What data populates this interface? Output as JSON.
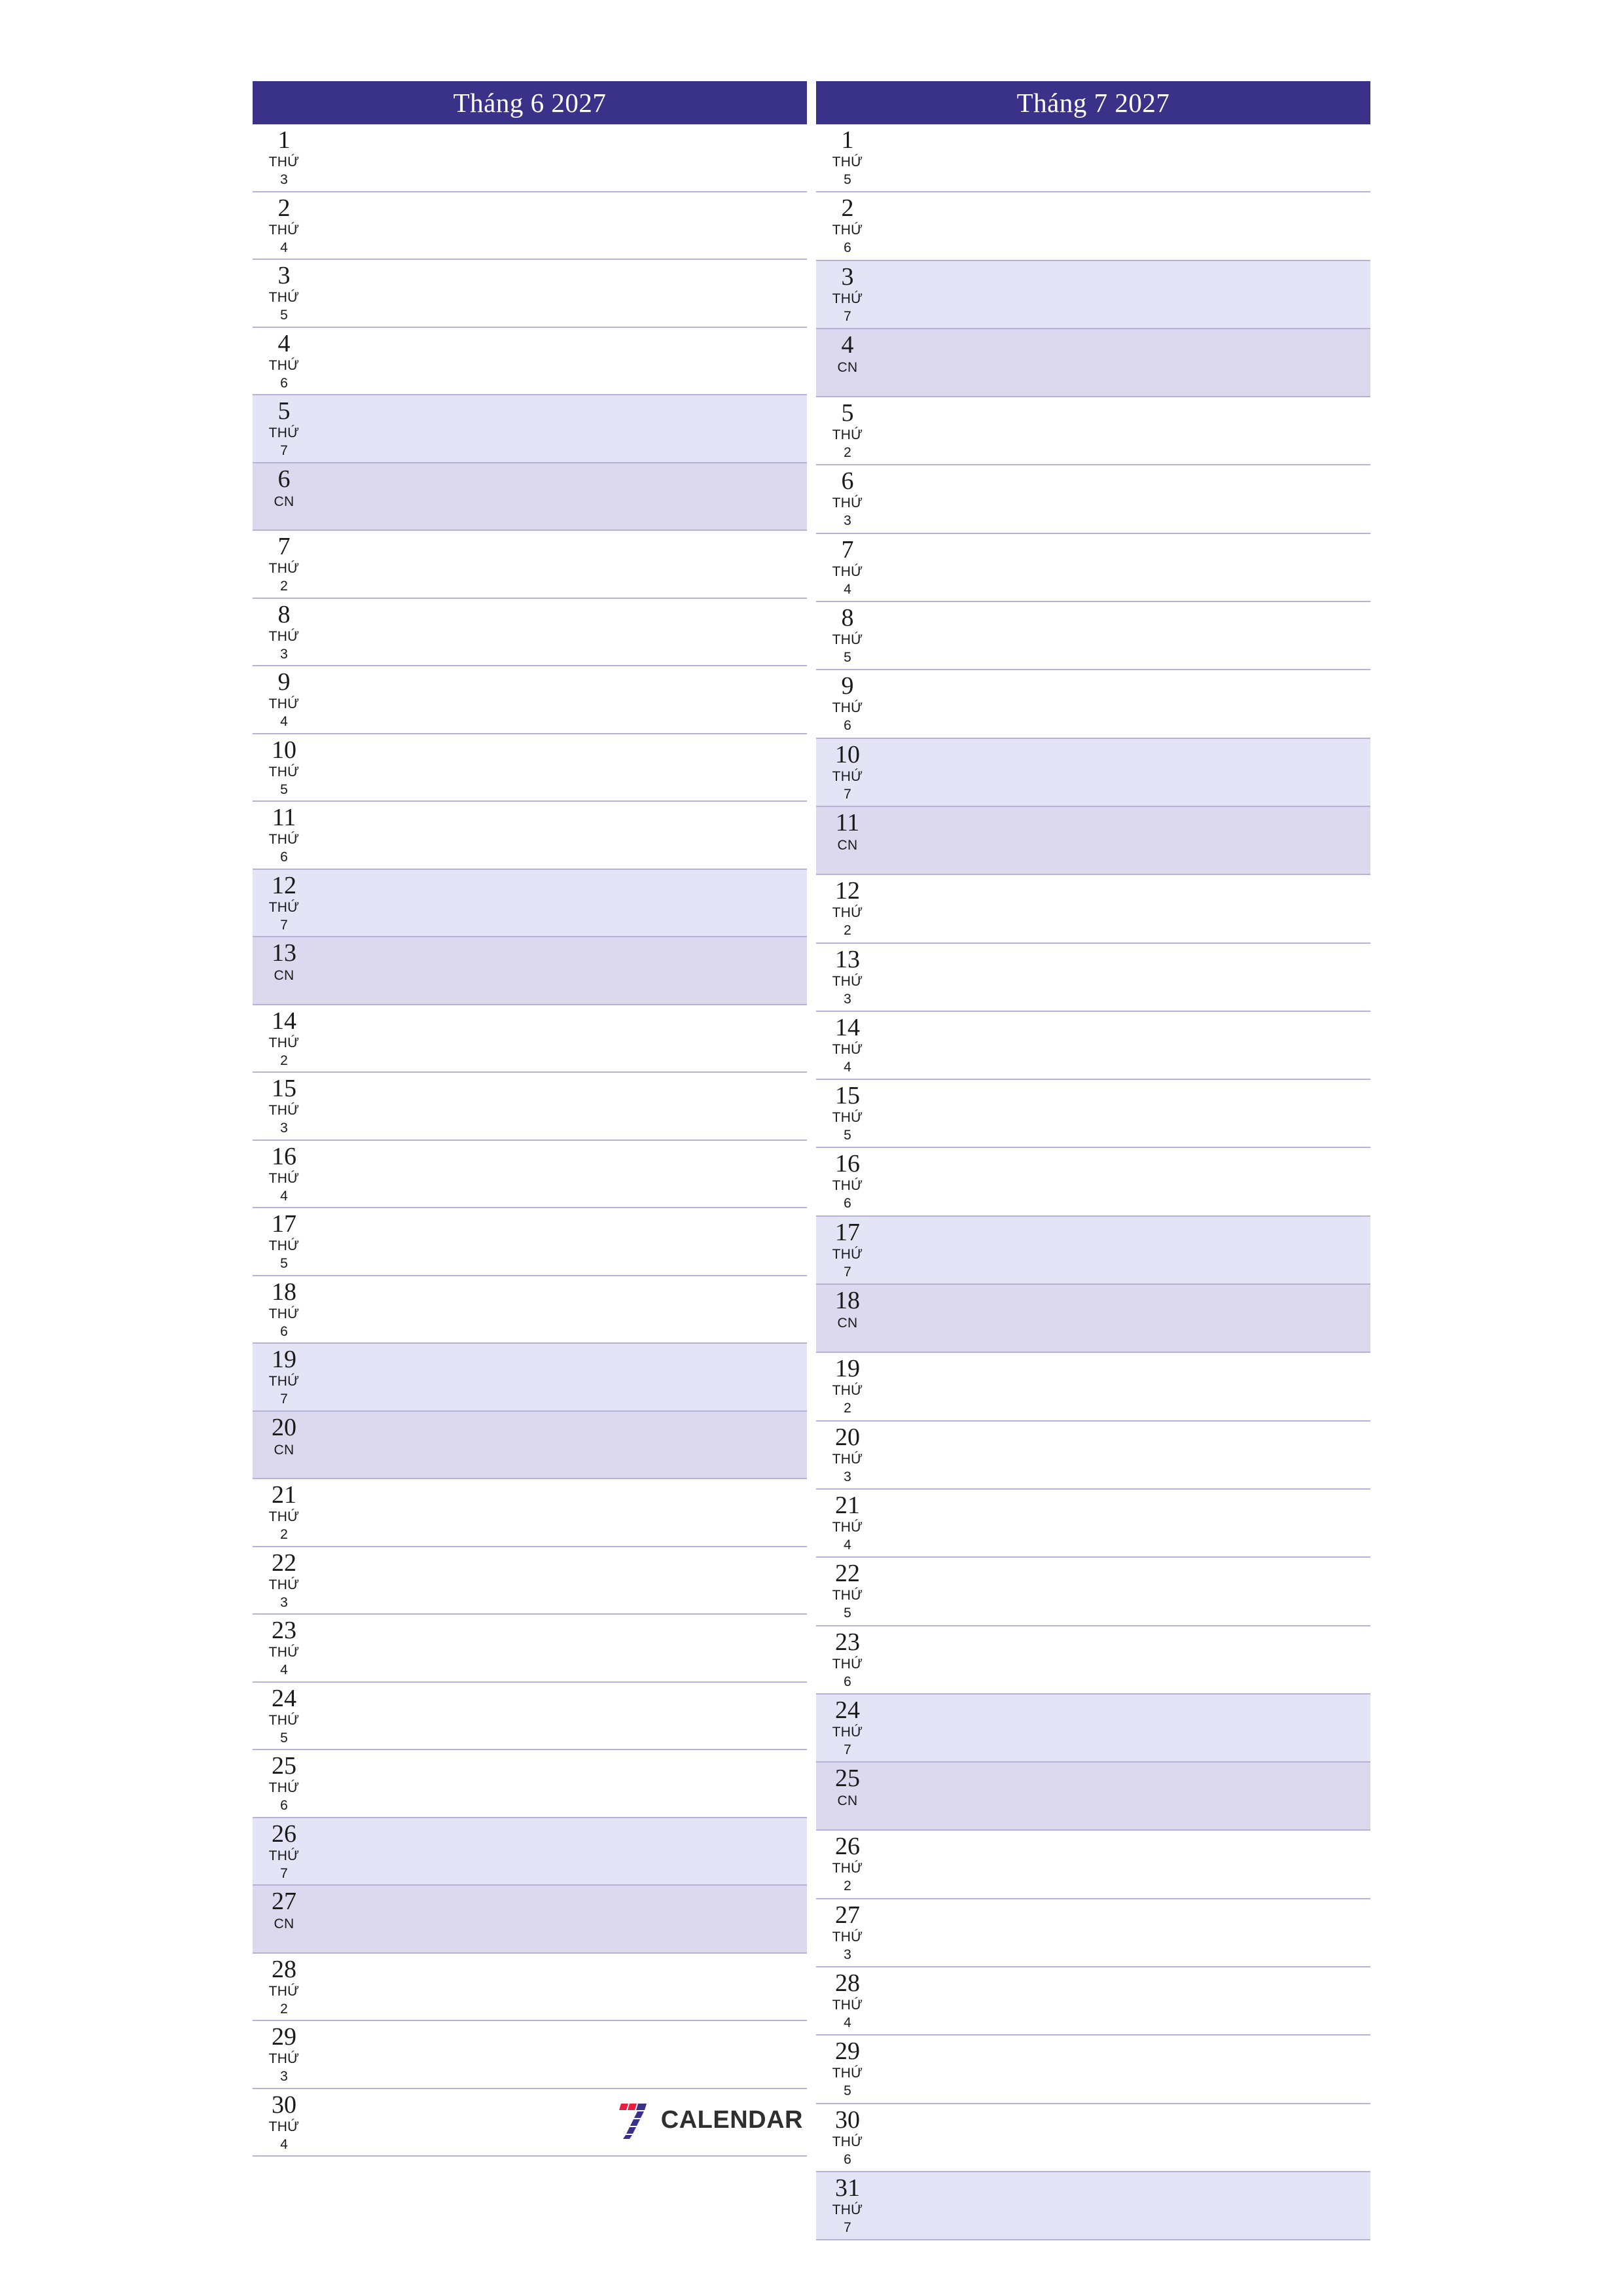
{
  "page": {
    "background_color": "#ffffff",
    "accent_color": "#3a3189",
    "saturday_color": "#e4e4f7",
    "sunday_color": "#dcd8ed",
    "rule_color": "#b5b2d6"
  },
  "logo": {
    "mark": "seven-stripes-icon",
    "text": "CALENDAR",
    "stripe_red": "#ec1c3d",
    "stripe_blue": "#3a3189"
  },
  "months": [
    {
      "title": "Tháng 6 2027",
      "name": "Tháng 6",
      "year": "2027",
      "days": [
        {
          "num": "1",
          "dow_word": "THỨ",
          "dow_num": "3",
          "type": "weekday"
        },
        {
          "num": "2",
          "dow_word": "THỨ",
          "dow_num": "4",
          "type": "weekday"
        },
        {
          "num": "3",
          "dow_word": "THỨ",
          "dow_num": "5",
          "type": "weekday"
        },
        {
          "num": "4",
          "dow_word": "THỨ",
          "dow_num": "6",
          "type": "weekday"
        },
        {
          "num": "5",
          "dow_word": "THỨ",
          "dow_num": "7",
          "type": "saturday"
        },
        {
          "num": "6",
          "dow_word": "CN",
          "dow_num": "",
          "type": "sunday"
        },
        {
          "num": "7",
          "dow_word": "THỨ",
          "dow_num": "2",
          "type": "weekday"
        },
        {
          "num": "8",
          "dow_word": "THỨ",
          "dow_num": "3",
          "type": "weekday"
        },
        {
          "num": "9",
          "dow_word": "THỨ",
          "dow_num": "4",
          "type": "weekday"
        },
        {
          "num": "10",
          "dow_word": "THỨ",
          "dow_num": "5",
          "type": "weekday"
        },
        {
          "num": "11",
          "dow_word": "THỨ",
          "dow_num": "6",
          "type": "weekday"
        },
        {
          "num": "12",
          "dow_word": "THỨ",
          "dow_num": "7",
          "type": "saturday"
        },
        {
          "num": "13",
          "dow_word": "CN",
          "dow_num": "",
          "type": "sunday"
        },
        {
          "num": "14",
          "dow_word": "THỨ",
          "dow_num": "2",
          "type": "weekday"
        },
        {
          "num": "15",
          "dow_word": "THỨ",
          "dow_num": "3",
          "type": "weekday"
        },
        {
          "num": "16",
          "dow_word": "THỨ",
          "dow_num": "4",
          "type": "weekday"
        },
        {
          "num": "17",
          "dow_word": "THỨ",
          "dow_num": "5",
          "type": "weekday"
        },
        {
          "num": "18",
          "dow_word": "THỨ",
          "dow_num": "6",
          "type": "weekday"
        },
        {
          "num": "19",
          "dow_word": "THỨ",
          "dow_num": "7",
          "type": "saturday"
        },
        {
          "num": "20",
          "dow_word": "CN",
          "dow_num": "",
          "type": "sunday"
        },
        {
          "num": "21",
          "dow_word": "THỨ",
          "dow_num": "2",
          "type": "weekday"
        },
        {
          "num": "22",
          "dow_word": "THỨ",
          "dow_num": "3",
          "type": "weekday"
        },
        {
          "num": "23",
          "dow_word": "THỨ",
          "dow_num": "4",
          "type": "weekday"
        },
        {
          "num": "24",
          "dow_word": "THỨ",
          "dow_num": "5",
          "type": "weekday"
        },
        {
          "num": "25",
          "dow_word": "THỨ",
          "dow_num": "6",
          "type": "weekday"
        },
        {
          "num": "26",
          "dow_word": "THỨ",
          "dow_num": "7",
          "type": "saturday"
        },
        {
          "num": "27",
          "dow_word": "CN",
          "dow_num": "",
          "type": "sunday"
        },
        {
          "num": "28",
          "dow_word": "THỨ",
          "dow_num": "2",
          "type": "weekday"
        },
        {
          "num": "29",
          "dow_word": "THỨ",
          "dow_num": "3",
          "type": "weekday"
        },
        {
          "num": "30",
          "dow_word": "THỨ",
          "dow_num": "4",
          "type": "weekday"
        }
      ]
    },
    {
      "title": "Tháng 7 2027",
      "name": "Tháng 7",
      "year": "2027",
      "days": [
        {
          "num": "1",
          "dow_word": "THỨ",
          "dow_num": "5",
          "type": "weekday"
        },
        {
          "num": "2",
          "dow_word": "THỨ",
          "dow_num": "6",
          "type": "weekday"
        },
        {
          "num": "3",
          "dow_word": "THỨ",
          "dow_num": "7",
          "type": "saturday"
        },
        {
          "num": "4",
          "dow_word": "CN",
          "dow_num": "",
          "type": "sunday"
        },
        {
          "num": "5",
          "dow_word": "THỨ",
          "dow_num": "2",
          "type": "weekday"
        },
        {
          "num": "6",
          "dow_word": "THỨ",
          "dow_num": "3",
          "type": "weekday"
        },
        {
          "num": "7",
          "dow_word": "THỨ",
          "dow_num": "4",
          "type": "weekday"
        },
        {
          "num": "8",
          "dow_word": "THỨ",
          "dow_num": "5",
          "type": "weekday"
        },
        {
          "num": "9",
          "dow_word": "THỨ",
          "dow_num": "6",
          "type": "weekday"
        },
        {
          "num": "10",
          "dow_word": "THỨ",
          "dow_num": "7",
          "type": "saturday"
        },
        {
          "num": "11",
          "dow_word": "CN",
          "dow_num": "",
          "type": "sunday"
        },
        {
          "num": "12",
          "dow_word": "THỨ",
          "dow_num": "2",
          "type": "weekday"
        },
        {
          "num": "13",
          "dow_word": "THỨ",
          "dow_num": "3",
          "type": "weekday"
        },
        {
          "num": "14",
          "dow_word": "THỨ",
          "dow_num": "4",
          "type": "weekday"
        },
        {
          "num": "15",
          "dow_word": "THỨ",
          "dow_num": "5",
          "type": "weekday"
        },
        {
          "num": "16",
          "dow_word": "THỨ",
          "dow_num": "6",
          "type": "weekday"
        },
        {
          "num": "17",
          "dow_word": "THỨ",
          "dow_num": "7",
          "type": "saturday"
        },
        {
          "num": "18",
          "dow_word": "CN",
          "dow_num": "",
          "type": "sunday"
        },
        {
          "num": "19",
          "dow_word": "THỨ",
          "dow_num": "2",
          "type": "weekday"
        },
        {
          "num": "20",
          "dow_word": "THỨ",
          "dow_num": "3",
          "type": "weekday"
        },
        {
          "num": "21",
          "dow_word": "THỨ",
          "dow_num": "4",
          "type": "weekday"
        },
        {
          "num": "22",
          "dow_word": "THỨ",
          "dow_num": "5",
          "type": "weekday"
        },
        {
          "num": "23",
          "dow_word": "THỨ",
          "dow_num": "6",
          "type": "weekday"
        },
        {
          "num": "24",
          "dow_word": "THỨ",
          "dow_num": "7",
          "type": "saturday"
        },
        {
          "num": "25",
          "dow_word": "CN",
          "dow_num": "",
          "type": "sunday"
        },
        {
          "num": "26",
          "dow_word": "THỨ",
          "dow_num": "2",
          "type": "weekday"
        },
        {
          "num": "27",
          "dow_word": "THỨ",
          "dow_num": "3",
          "type": "weekday"
        },
        {
          "num": "28",
          "dow_word": "THỨ",
          "dow_num": "4",
          "type": "weekday"
        },
        {
          "num": "29",
          "dow_word": "THỨ",
          "dow_num": "5",
          "type": "weekday"
        },
        {
          "num": "30",
          "dow_word": "THỨ",
          "dow_num": "6",
          "type": "weekday"
        },
        {
          "num": "31",
          "dow_word": "THỨ",
          "dow_num": "7",
          "type": "saturday"
        }
      ]
    }
  ]
}
